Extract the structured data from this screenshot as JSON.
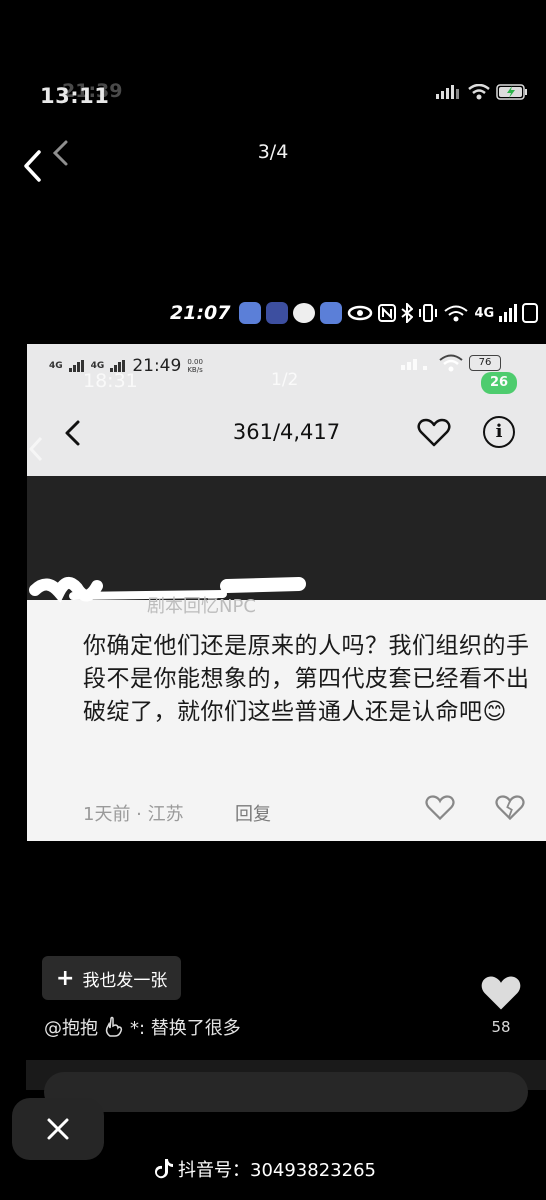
{
  "outer_status": {
    "time": "13:11",
    "time_ghost": "21:39"
  },
  "nav": {
    "page_counter": "3/4"
  },
  "mid_status": {
    "time": "21:07",
    "network": "4G"
  },
  "screenshot": {
    "status": {
      "signal_a": "4G",
      "signal_b": "4G",
      "time": "21:49",
      "speed_value": "0.00",
      "speed_unit": "KB/s",
      "battery": "76",
      "ghost_time": "18:31",
      "ghost_page": "1/2",
      "ghost_battery": "26"
    },
    "counter": "361/4,417",
    "comment": {
      "username": "剧本回忆NPC",
      "text": "你确定他们还是原来的人吗？我们组织的手段不是你能想象的，第四代皮套已经看不出破绽了，就你们这些普通人还是认命吧",
      "emoji": "😊",
      "meta": "1天前 · 江苏",
      "reply": "回复"
    }
  },
  "bottom": {
    "me_too": "我也发一张",
    "caption_user": "@抱抱",
    "caption_text": "*:  替换了很多",
    "likes": "58"
  },
  "watermark": {
    "label": "抖音号：30493823265"
  },
  "colors": {
    "background": "#000000",
    "card_top": "#e9e9ea",
    "card_dark": "#232323",
    "accent_battery": "#34c759"
  }
}
